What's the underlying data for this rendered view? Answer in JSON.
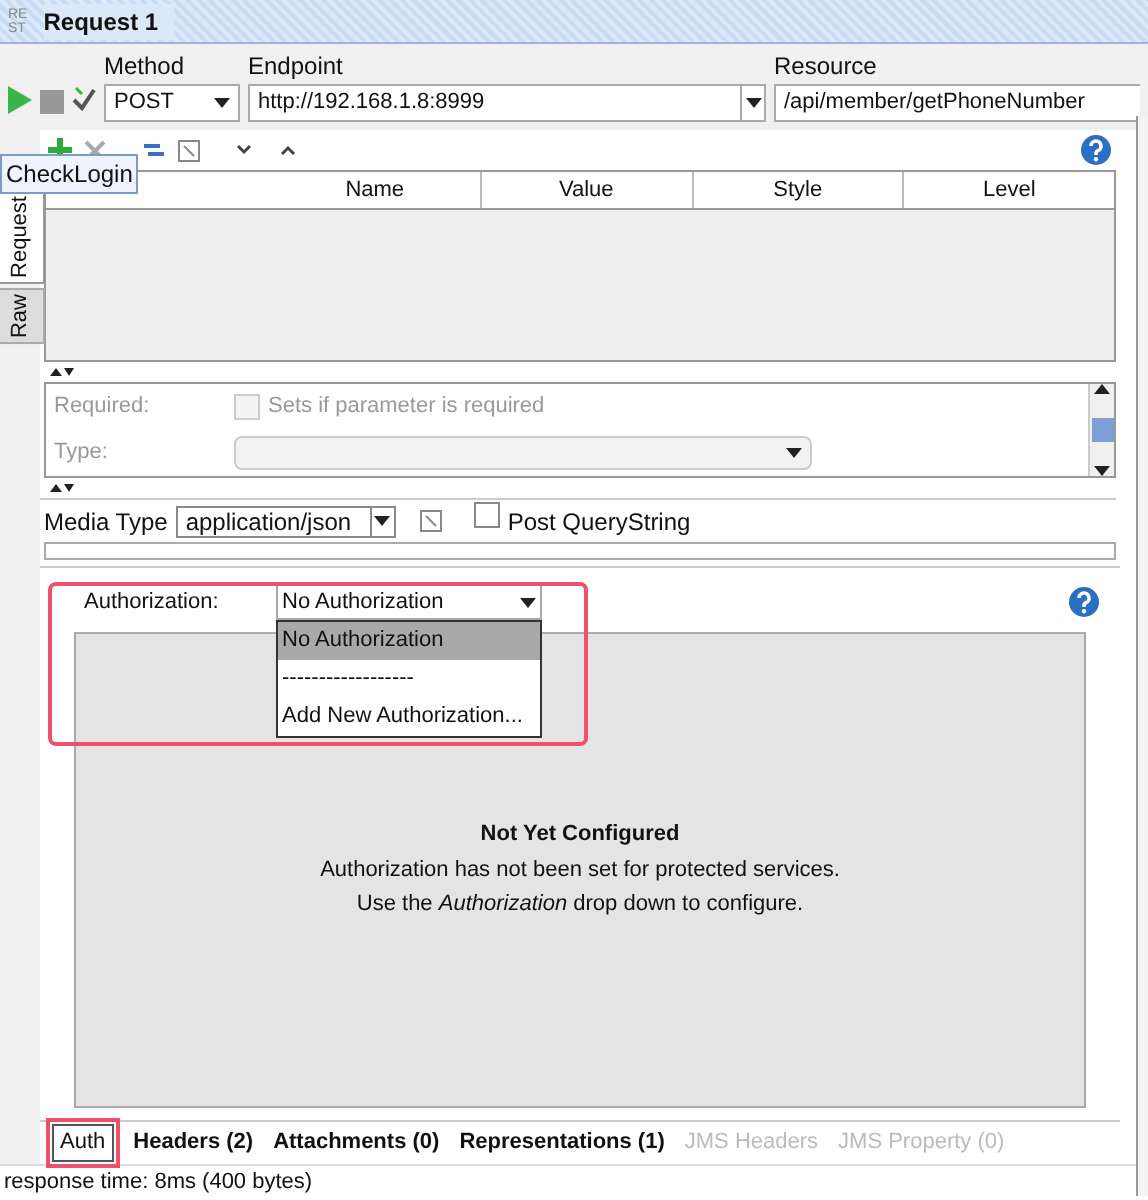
{
  "window": {
    "logo_lines": [
      "RE",
      "ST"
    ],
    "title": "Request 1"
  },
  "toolbar": {
    "method_label": "Method",
    "method": "POST",
    "endpoint_label": "Endpoint",
    "endpoint": "http://192.168.1.8:8999",
    "resource_label": "Resource",
    "resource": "/api/member/getPhoneNumber"
  },
  "side_tabs": [
    {
      "label": "Request",
      "selected": true
    },
    {
      "label": "Raw",
      "selected": false
    }
  ],
  "tooltip": "CheckLogin",
  "params": {
    "columns": [
      "Name",
      "Value",
      "Style",
      "Level"
    ],
    "required_label": "Required:",
    "required_checkbox": {
      "label": "Sets if parameter is required",
      "checked": false
    },
    "type_label": "Type:"
  },
  "media": {
    "label": "Media Type",
    "value": "application/json",
    "post_querystring": {
      "label": "Post QueryString",
      "checked": false
    }
  },
  "auth": {
    "label": "Authorization:",
    "value": "No Authorization",
    "options": [
      {
        "label": "No Authorization",
        "selected": true
      },
      {
        "label": "------------------",
        "selected": false
      },
      {
        "label": "Add New Authorization...",
        "selected": false
      }
    ],
    "title": "Not Yet Configured",
    "line1": "Authorization has not been set for protected services.",
    "line2": "Use the *Authorization* drop down to configure."
  },
  "bottom_tabs": [
    {
      "label": "Auth",
      "selected": true,
      "disabled": false
    },
    {
      "label": "Headers (2)",
      "selected": false,
      "disabled": false
    },
    {
      "label": "Attachments (0)",
      "selected": false,
      "disabled": false
    },
    {
      "label": "Representations (1)",
      "selected": false,
      "disabled": false
    },
    {
      "label": "JMS Headers",
      "selected": false,
      "disabled": true
    },
    {
      "label": "JMS Property (0)",
      "selected": false,
      "disabled": true
    }
  ],
  "status": "response time: 8ms (400 bytes)"
}
